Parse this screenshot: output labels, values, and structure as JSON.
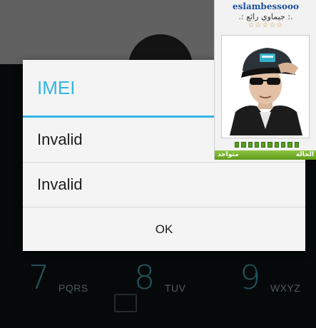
{
  "dialog": {
    "title": "IMEI",
    "rows": [
      "Invalid",
      "Invalid"
    ],
    "ok_label": "OK",
    "accent_color": "#33b5e5"
  },
  "dialer": {
    "keys": [
      {
        "digit": "7",
        "letters": "PQRS"
      },
      {
        "digit": "8",
        "letters": "TUV"
      },
      {
        "digit": "9",
        "letters": "WXYZ"
      }
    ]
  },
  "forum_card": {
    "username": "eslambessooo",
    "user_title": ".: جيماوي رائع :.",
    "stars": "☆☆☆☆☆",
    "status_label": "الحالة",
    "status_value": "متواجد",
    "status_color": "#6aa822"
  }
}
